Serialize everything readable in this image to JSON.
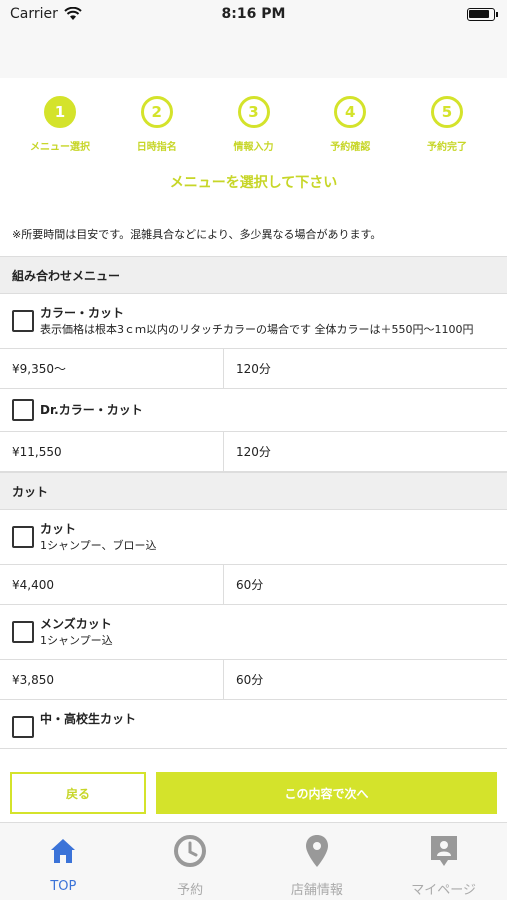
{
  "status": {
    "carrier": "Carrier",
    "time": "8:16 PM"
  },
  "steps": [
    {
      "num": "1",
      "label": "メニュー選択",
      "active": true
    },
    {
      "num": "2",
      "label": "日時指名",
      "active": false
    },
    {
      "num": "3",
      "label": "情報入力",
      "active": false
    },
    {
      "num": "4",
      "label": "予約確認",
      "active": false
    },
    {
      "num": "5",
      "label": "予約完了",
      "active": false
    }
  ],
  "heading": "メニューを選択して下さい",
  "notice": "※所要時間は目安です。混雑具合などにより、多少異なる場合があります。",
  "sections": [
    {
      "title": "組み合わせメニュー",
      "items": [
        {
          "name": "カラー・カット",
          "desc": "表示価格は根本3ｃｍ以内のリタッチカラーの場合です 全体カラーは＋550円〜1100円",
          "price": "¥9,350〜",
          "time": "120分"
        },
        {
          "name": "Dr.カラー・カット",
          "desc": "",
          "price": "¥11,550",
          "time": "120分"
        }
      ]
    },
    {
      "title": "カット",
      "items": [
        {
          "name": "カット",
          "desc": "1シャンプー、ブロー込",
          "price": "¥4,400",
          "time": "60分"
        },
        {
          "name": "メンズカット",
          "desc": "1シャンプー込",
          "price": "¥3,850",
          "time": "60分"
        },
        {
          "name": "中・高校生カット",
          "desc": "",
          "price": "",
          "time": ""
        }
      ]
    }
  ],
  "actions": {
    "back": "戻る",
    "next": "この内容で次へ"
  },
  "tabs": [
    {
      "label": "TOP",
      "icon": "home-icon",
      "active": true
    },
    {
      "label": "予約",
      "icon": "clock-icon",
      "active": false
    },
    {
      "label": "店舗情報",
      "icon": "location-pin-icon",
      "active": false
    },
    {
      "label": "マイページ",
      "icon": "profile-icon",
      "active": false
    }
  ],
  "colors": {
    "accent": "#d4e32b",
    "tab_active": "#3b73d8"
  }
}
